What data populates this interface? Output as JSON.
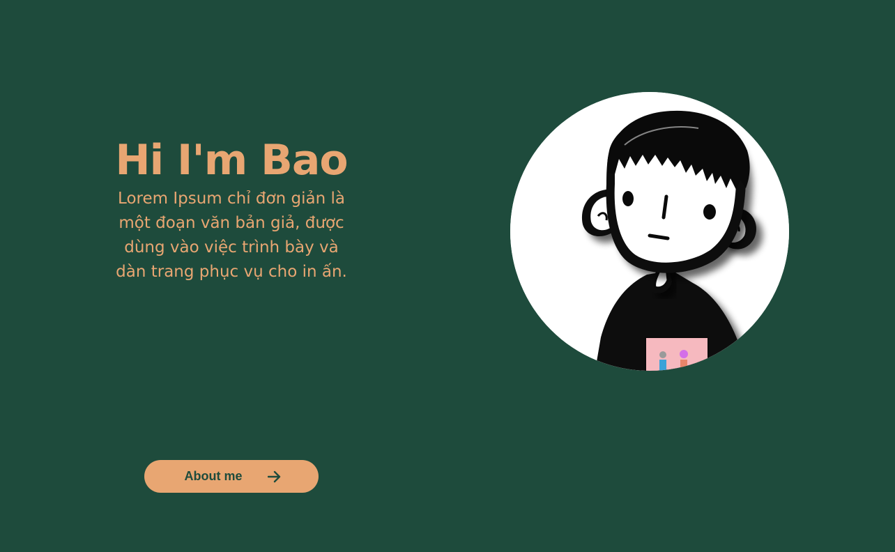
{
  "hero": {
    "title": "Hi I'm Bao",
    "description": "Lorem Ipsum chỉ đơn giản là một đoạn văn bản giả, được dùng vào việc trình bày và dàn trang phục vụ cho in ấn."
  },
  "about_button": {
    "label": "About me",
    "icon": "arrow-right-icon"
  },
  "avatar": {
    "icon": "avatar-illustration"
  },
  "colors": {
    "background": "#1e4b3c",
    "accent": "#e8a672",
    "avatar_background": "#ffffff"
  }
}
